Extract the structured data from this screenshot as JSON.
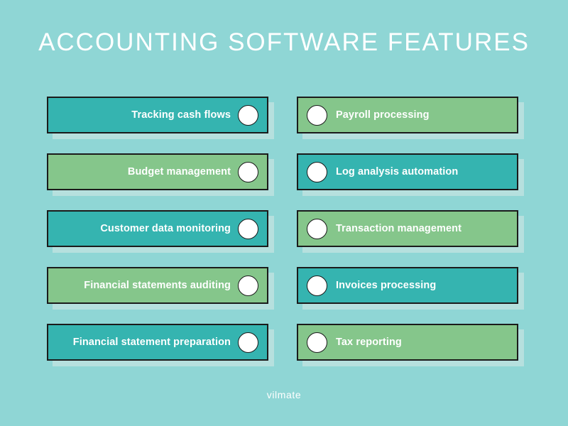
{
  "background_color": "#8fd6d5",
  "header": {
    "title": "ACCOUNTING SOFTWARE FEATURES"
  },
  "footer": {
    "brand": "vilmate"
  },
  "colors": {
    "teal": "#35b4b0",
    "green": "#85c68b",
    "shadow": "#b6e0de",
    "border": "#1b1b1b",
    "bullet": "#ffffff",
    "text": "#ffffff"
  },
  "features": {
    "left_column": [
      {
        "label": "Tracking cash flows",
        "color": "teal",
        "bullet_side": "right"
      },
      {
        "label": "Budget management",
        "color": "green",
        "bullet_side": "right"
      },
      {
        "label": "Customer data monitoring",
        "color": "teal",
        "bullet_side": "right"
      },
      {
        "label": "Financial statements auditing",
        "color": "green",
        "bullet_side": "right"
      },
      {
        "label": "Financial statement preparation",
        "color": "teal",
        "bullet_side": "right"
      }
    ],
    "right_column": [
      {
        "label": "Payroll processing",
        "color": "green",
        "bullet_side": "left"
      },
      {
        "label": "Log analysis automation",
        "color": "teal",
        "bullet_side": "left"
      },
      {
        "label": "Transaction management",
        "color": "green",
        "bullet_side": "left"
      },
      {
        "label": "Invoices processing",
        "color": "teal",
        "bullet_side": "left"
      },
      {
        "label": "Tax reporting",
        "color": "green",
        "bullet_side": "left"
      }
    ]
  }
}
